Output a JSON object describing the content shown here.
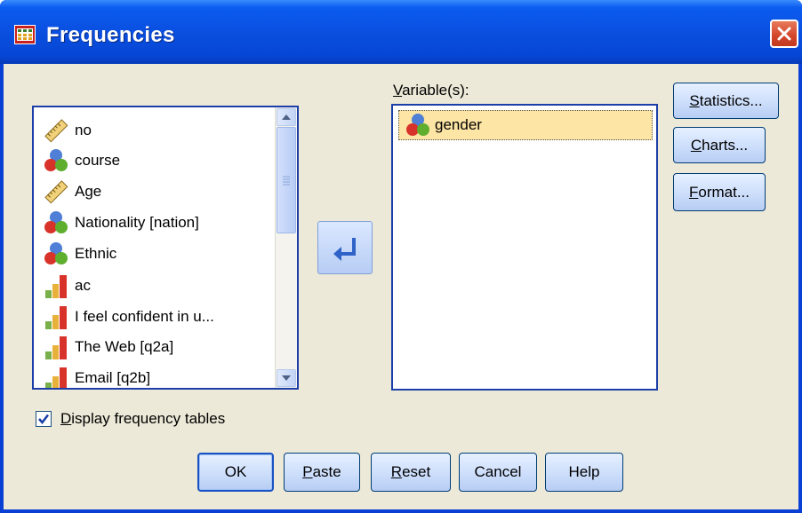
{
  "window": {
    "title": "Frequencies"
  },
  "source_list": {
    "items": [
      {
        "label": "no",
        "icon": "scale-ruler-icon"
      },
      {
        "label": "course",
        "icon": "nominal-circles-icon"
      },
      {
        "label": "Age",
        "icon": "scale-ruler-icon"
      },
      {
        "label": "Nationality [nation]",
        "icon": "nominal-circles-icon"
      },
      {
        "label": "Ethnic",
        "icon": "nominal-circles-icon"
      },
      {
        "label": "ac",
        "icon": "ordinal-bars-icon"
      },
      {
        "label": "I feel confident in u...",
        "icon": "ordinal-bars-icon"
      },
      {
        "label": "The Web [q2a]",
        "icon": "ordinal-bars-icon"
      },
      {
        "label": "Email [q2b]",
        "icon": "ordinal-bars-icon"
      }
    ]
  },
  "target": {
    "label_access": "V",
    "label_rest": "ariable(s):",
    "items": [
      {
        "label": "gender",
        "icon": "nominal-circles-icon"
      }
    ]
  },
  "side_buttons": {
    "statistics": {
      "access": "S",
      "rest": "tatistics..."
    },
    "charts": {
      "access": "C",
      "rest": "harts..."
    },
    "format": {
      "access": "F",
      "rest": "ormat..."
    }
  },
  "checkbox": {
    "access": "D",
    "rest": "isplay frequency tables",
    "checked": true
  },
  "bottom_buttons": {
    "ok": "OK",
    "paste_access": "P",
    "paste_rest": "aste",
    "reset_access": "R",
    "reset_rest": "eset",
    "cancel": "Cancel",
    "help": "Help"
  },
  "colors": {
    "title_bar": "#0a4fe0",
    "dialog_face": "#ece9d8",
    "list_border": "#1c3ea8",
    "selection": "#fde5a5"
  }
}
